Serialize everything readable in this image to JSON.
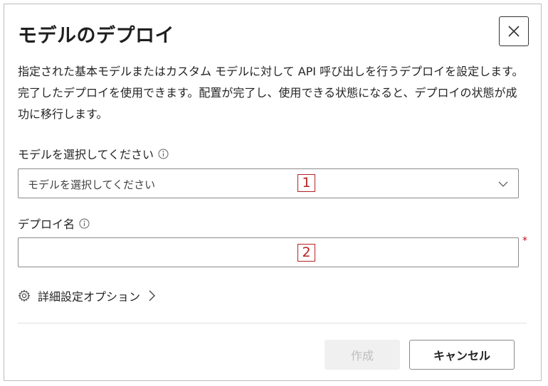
{
  "dialog": {
    "title": "モデルのデプロイ",
    "close_icon": "close-icon",
    "description": "指定された基本モデルまたはカスタム モデルに対して API 呼び出しを行うデプロイを設定します。完了したデプロイを使用できます。配置が完了し、使用できる状態になると、デプロイの状態が成功に移行します。"
  },
  "model_field": {
    "label": "モデルを選択してください",
    "info_icon": "info-icon",
    "selected_value": "モデルを選択してください",
    "marker": "1"
  },
  "deploy_name_field": {
    "label": "デプロイ名",
    "info_icon": "info-icon",
    "value": "",
    "required_mark": "*",
    "marker": "2"
  },
  "advanced_options": {
    "icon": "gear-icon",
    "label": "詳細設定オプション",
    "chevron_icon": "chevron-right-icon"
  },
  "footer": {
    "create_label": "作成",
    "cancel_label": "キャンセル"
  },
  "colors": {
    "marker": "#b22222",
    "required": "#c50f1f",
    "disabled_bg": "#f0f0f0",
    "disabled_text": "#bdbdbd"
  }
}
